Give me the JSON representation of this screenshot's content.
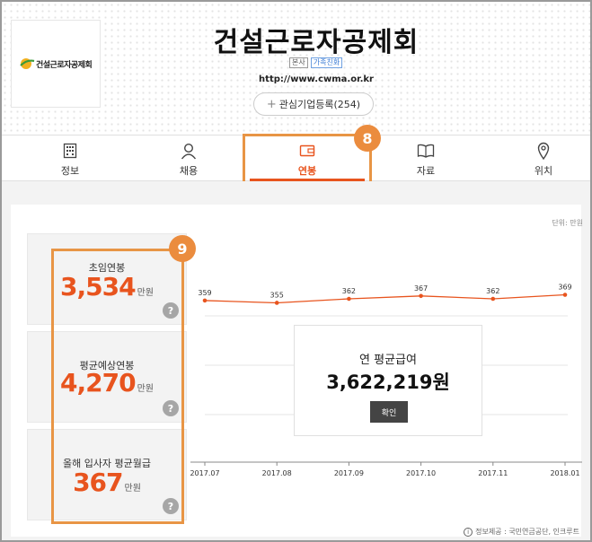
{
  "company": {
    "name": "건설근로자공제회",
    "logo_text": "건설근로자공제회",
    "badge_hq": "본사",
    "badge_family": "가족친화",
    "homepage": "http://www.cwma.or.kr",
    "follow_label": "관심기업등록(254)"
  },
  "tabs": [
    {
      "label": "정보",
      "icon": "building-icon"
    },
    {
      "label": "채용",
      "icon": "person-icon"
    },
    {
      "label": "연봉",
      "icon": "wallet-icon",
      "active": true
    },
    {
      "label": "자료",
      "icon": "book-icon"
    },
    {
      "label": "위치",
      "icon": "location-pin-icon"
    }
  ],
  "markers": {
    "tab_marker": "8",
    "stats_marker": "9"
  },
  "unit_note": "단위: 만원",
  "stats": [
    {
      "title": "초임연봉",
      "value": "3,534",
      "unit": "만원"
    },
    {
      "title": "평균예상연봉",
      "value": "4,270",
      "unit": "만원"
    },
    {
      "title": "올해 입사자 평균월급",
      "value": "367",
      "unit": "만원"
    }
  ],
  "help_label": "?",
  "overlay": {
    "title": "연 평균급여",
    "value": "3,622,219원",
    "confirm_label": "확인"
  },
  "source": "정보제공 : 국민연금공단, 인크루트",
  "colors": {
    "accent": "#e8541e",
    "highlight": "#eb8c3e"
  },
  "chart_data": {
    "type": "line",
    "categories": [
      "2017.07",
      "2017.08",
      "2017.09",
      "2017.10",
      "2017.11",
      "2018.01"
    ],
    "series": [
      {
        "values": [
          359,
          355,
          362,
          367,
          362,
          369
        ]
      }
    ],
    "xlabel": "",
    "ylabel": "",
    "ylim": [
      0,
      380
    ],
    "grid": true
  }
}
